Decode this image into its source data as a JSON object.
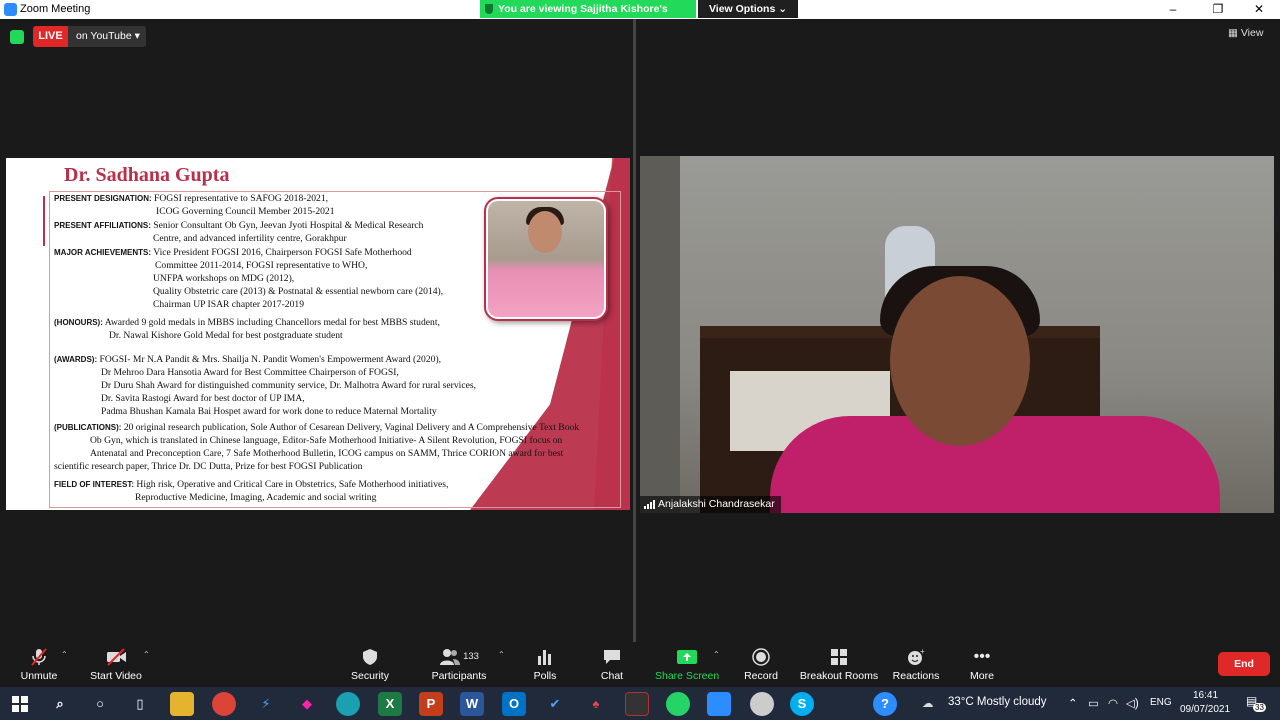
{
  "window": {
    "title": "Zoom Meeting",
    "minimize": "–",
    "maximize": "❐",
    "close": "✕"
  },
  "banner": {
    "viewing_text": "You are viewing Sajjitha Kishore's screen",
    "view_options": "View Options ⌄"
  },
  "meeting": {
    "live_label": "LIVE",
    "live_destination": "on YouTube ▾",
    "view_label": "▦ View"
  },
  "slide": {
    "title": "Dr. Sadhana Gupta",
    "lines": [
      {
        "label": "PRESENT DESIGNATION:",
        "text": "FOGSI representative to SAFOG 2018-2021,"
      },
      {
        "label": "",
        "text": "ICOG Governing Council Member 2015-2021"
      },
      {
        "label": "PRESENT AFFILIATIONS:",
        "text": "Senior Consultant Ob Gyn, Jeevan Jyoti Hospital & Medical Research"
      },
      {
        "label": "",
        "text": "Centre, and advanced infertility centre, Gorakhpur"
      },
      {
        "label": "MAJOR ACHIEVEMENTS:",
        "text": "Vice President FOGSI 2016, Chairperson FOGSI Safe Motherhood"
      },
      {
        "label": "",
        "text": "Committee 2011-2014, FOGSI representative to WHO,"
      },
      {
        "label": "",
        "text": "UNFPA workshops on MDG (2012),"
      },
      {
        "label": "",
        "text": "Quality Obstetric care (2013) & Postnatal & essential newborn care (2014),"
      },
      {
        "label": "",
        "text": "Chairman UP ISAR chapter 2017-2019"
      },
      {
        "label": "(HONOURS):",
        "text": " Awarded 9 gold medals in MBBS including Chancellors medal for best MBBS student,"
      },
      {
        "label": "",
        "text": "Dr. Nawal Kishore Gold Medal for best postgraduate student"
      },
      {
        "label": "(AWARDS):",
        "text": "FOGSI- Mr N.A Pandit & Mrs. Shailja N. Pandit Women's Empowerment Award (2020),"
      },
      {
        "label": "",
        "text": "Dr Mehroo Dara Hansotia Award for Best Committee Chairperson of FOGSI,"
      },
      {
        "label": "",
        "text": "Dr Duru Shah Award for distinguished community service, Dr. Malhotra Award for rural services,"
      },
      {
        "label": "",
        "text": "Dr. Savita Rastogi Award for best doctor of UP IMA,"
      },
      {
        "label": "",
        "text": "Padma Bhushan Kamala Bai Hospet award for work done to reduce Maternal Mortality"
      },
      {
        "label": "(PUBLICATIONS):",
        "text": "20 original research publication, Sole Author of Cesarean Delivery, Vaginal Delivery and A Comprehensive Text Book"
      },
      {
        "label": "",
        "text": "Ob Gyn, which is translated in Chinese language, Editor-Safe Motherhood Initiative- A Silent Revolution, FOGSI focus on"
      },
      {
        "label": "",
        "text": "Antenatal and Preconception  Care, 7 Safe Motherhood Bulletin, ICOG campus on SAMM, Thrice CORION award for best"
      },
      {
        "label": "",
        "text": "scientific research paper, Thrice Dr. DC Dutta, Prize for best FOGSI Publication"
      },
      {
        "label": "FIELD OF INTEREST:",
        "text": "High risk, Operative and Critical Care in Obstetrics, Safe Motherhood initiatives,"
      },
      {
        "label": "",
        "text": "Reproductive Medicine, Imaging, Academic and social writing"
      }
    ]
  },
  "video": {
    "participant_name": "Anjalakshi Chandrasekar"
  },
  "toolbar": {
    "unmute": "Unmute",
    "start_video": "Start Video",
    "security": "Security",
    "participants": "Participants",
    "participants_count": "133",
    "polls": "Polls",
    "chat": "Chat",
    "share_screen": "Share Screen",
    "record": "Record",
    "breakout_rooms": "Breakout Rooms",
    "reactions": "Reactions",
    "more": "More",
    "end": "End"
  },
  "taskbar": {
    "weather": "33°C  Mostly cloudy",
    "language": "ENG",
    "time": "16:41",
    "date": "09/07/2021",
    "notifications": "33"
  },
  "colors": {
    "zoom_blue": "#2d8cff",
    "live_red": "#e02828",
    "share_green": "#23d959",
    "slide_accent": "#b8304a"
  }
}
